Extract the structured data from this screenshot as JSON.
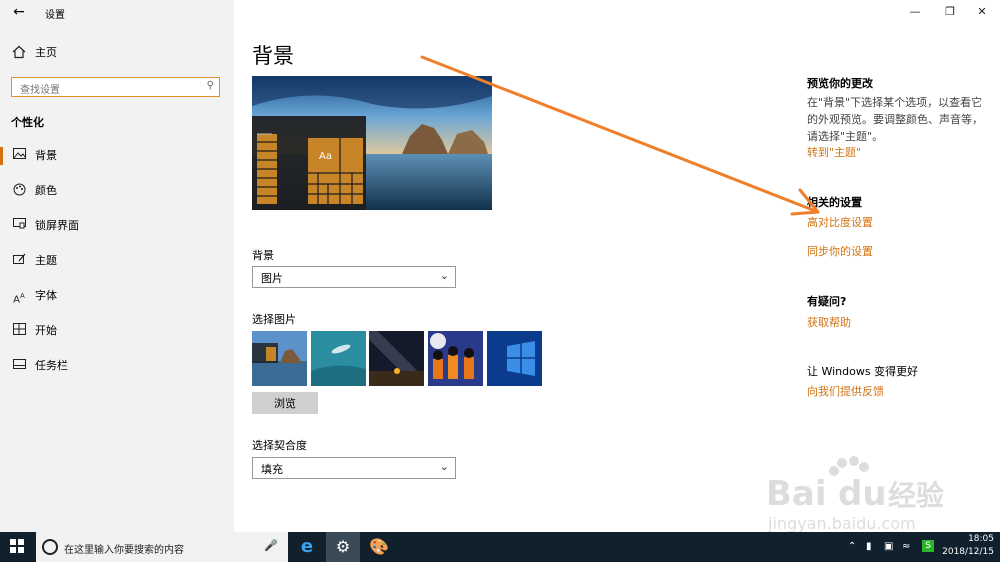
{
  "window": {
    "title": "设置",
    "min_icon": "minimize-icon",
    "max_icon": "maximize-icon",
    "close_icon": "close-icon"
  },
  "sidebar": {
    "home_label": "主页",
    "search_placeholder": "查找设置",
    "section_title": "个性化",
    "items": [
      {
        "label": "背景",
        "icon": "picture-icon",
        "active": true
      },
      {
        "label": "颜色",
        "icon": "palette-icon"
      },
      {
        "label": "锁屏界面",
        "icon": "lock-screen-icon"
      },
      {
        "label": "主题",
        "icon": "theme-icon"
      },
      {
        "label": "字体",
        "icon": "font-icon"
      },
      {
        "label": "开始",
        "icon": "start-icon"
      },
      {
        "label": "任务栏",
        "icon": "taskbar-icon"
      }
    ]
  },
  "main": {
    "title": "背景",
    "preview_tile_text": "Aa",
    "background_label": "背景",
    "background_value": "图片",
    "choose_picture_label": "选择图片",
    "browse_label": "浏览",
    "fit_label": "选择契合度",
    "fit_value": "填充"
  },
  "right": {
    "preview_heading": "预览你的更改",
    "preview_text": "在\"背景\"下选择某个选项，以查看它的外观预览。要调整颜色、声音等，请选择\"主题\"。",
    "go_to_themes": "转到\"主题\"",
    "related_heading": "相关的设置",
    "high_contrast": "高对比度设置",
    "sync_settings": "同步你的设置",
    "question_heading": "有疑问?",
    "get_help": "获取帮助",
    "improve_heading": "让 Windows 变得更好",
    "feedback": "向我们提供反馈"
  },
  "taskbar": {
    "search_placeholder": "在这里输入你要搜索的内容",
    "time": "18:05",
    "date": "2018/12/15"
  },
  "watermark": {
    "brand": "Bai du 经验",
    "url": "jingyan.baidu.com"
  },
  "colors": {
    "accent": "#d2730f",
    "taskbar": "#10202c",
    "annotation_arrow": "#f07f2a"
  }
}
